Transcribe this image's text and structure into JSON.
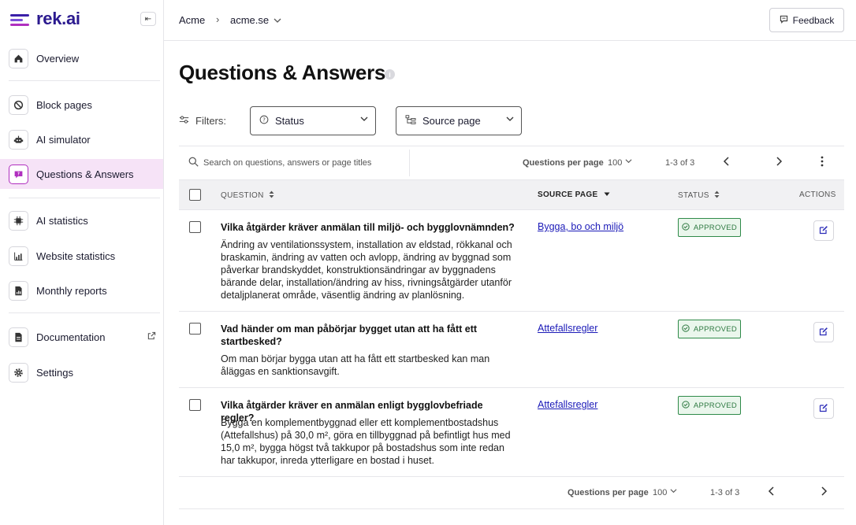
{
  "app": {
    "logo_text": "rek.ai",
    "brand_color": "#2b1a8f",
    "accent_color": "#b02fbf"
  },
  "sidebar": {
    "collapse_icon": "collapse-icon",
    "items": [
      {
        "label": "Overview",
        "icon": "home-icon"
      },
      {
        "label": "Block pages",
        "icon": "block-icon"
      },
      {
        "label": "AI simulator",
        "icon": "robot-icon"
      },
      {
        "label": "Questions & Answers",
        "icon": "chat-icon",
        "active": true
      },
      {
        "label": "AI statistics",
        "icon": "chip-icon"
      },
      {
        "label": "Website statistics",
        "icon": "bar-chart-icon"
      },
      {
        "label": "Monthly reports",
        "icon": "report-icon"
      },
      {
        "label": "Documentation",
        "icon": "document-icon",
        "external": true
      },
      {
        "label": "Settings",
        "icon": "gear-icon"
      }
    ]
  },
  "topbar": {
    "breadcrumb": [
      "Acme",
      "acme.se"
    ],
    "feedback_label": "Feedback"
  },
  "main": {
    "title": "Questions & Answers",
    "filters_label": "Filters:",
    "filters": [
      {
        "label": "Status",
        "icon": "status-icon"
      },
      {
        "label": "Source page",
        "icon": "sitemap-icon"
      }
    ]
  },
  "table": {
    "search_placeholder": "Search on questions, answers or page titles",
    "per_page_label": "Questions per page",
    "per_page_value": "100",
    "range": "1-3 of 3",
    "columns": {
      "question": "QUESTION",
      "source_page": "SOURCE PAGE",
      "status": "STATUS",
      "actions": "ACTIONS"
    },
    "rows": [
      {
        "question": "Vilka åtgärder kräver anmälan till miljö- och bygglovnämnden?",
        "answer": "Ändring av ventilationssystem, installation av eldstad, rökkanal och braskamin, ändring av vatten och avlopp, ändring av byggnad som påverkar brandskyddet, konstruktionsändringar av byggnadens bärande delar, installation/ändring av hiss, rivningsåtgärder utanför detaljplanerat område, väsentlig ändring av planlösning.",
        "source_page": "Bygga, bo och miljö",
        "status": "APPROVED"
      },
      {
        "question": "Vad händer om man påbörjar bygget utan att ha fått ett startbesked?",
        "answer": "Om man börjar bygga utan att ha fått ett startbesked kan man åläggas en sanktionsavgift.",
        "source_page": "Attefallsregler",
        "status": "APPROVED"
      },
      {
        "question": "Vilka åtgärder kräver en anmälan enligt bygglovbefriade regler?",
        "answer": "Bygga en komplementbyggnad eller ett komplementbostadshus (Attefallshus) på 30,0 m², göra en tillbyggnad på befintligt hus med 15,0 m², bygga högst två takkupor på bostadshus som inte redan har takkupor, inreda ytterligare en bostad i huset.",
        "source_page": "Attefallsregler",
        "status": "APPROVED"
      }
    ]
  }
}
